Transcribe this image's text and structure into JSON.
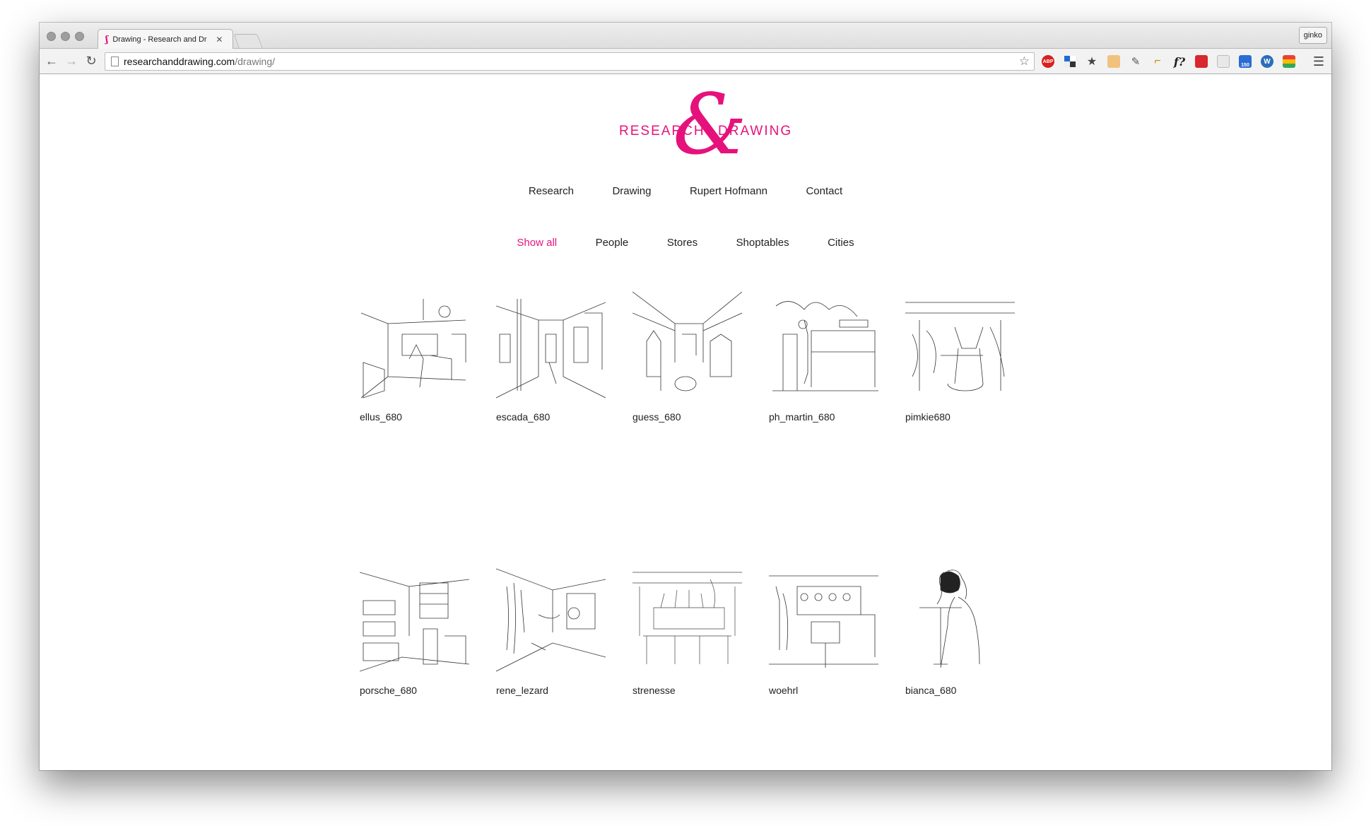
{
  "browser": {
    "tab_title": "Drawing - Research and Dr",
    "tab_close": "✕",
    "profile_name": "ginko",
    "url_host": "researchanddrawing.com",
    "url_path": "/drawing/",
    "extensions": [
      "ABP",
      "",
      "",
      "",
      "",
      "",
      "f?",
      "",
      "",
      "150",
      "",
      ""
    ]
  },
  "site": {
    "logo_left": "RESEARCH",
    "logo_amp": "&",
    "logo_right": "DRAWING",
    "brand_color": "#e6127c",
    "nav": [
      "Research",
      "Drawing",
      "Rupert Hofmann",
      "Contact"
    ],
    "filters": [
      "Show all",
      "People",
      "Stores",
      "Shoptables",
      "Cities"
    ],
    "active_filter": "Show all"
  },
  "gallery": [
    {
      "caption": "ellus_680"
    },
    {
      "caption": "escada_680"
    },
    {
      "caption": "guess_680"
    },
    {
      "caption": "ph_martin_680"
    },
    {
      "caption": "pimkie680"
    },
    {
      "caption": "porsche_680"
    },
    {
      "caption": "rene_lezard"
    },
    {
      "caption": "strenesse"
    },
    {
      "caption": "woehrl"
    },
    {
      "caption": "bianca_680"
    }
  ]
}
